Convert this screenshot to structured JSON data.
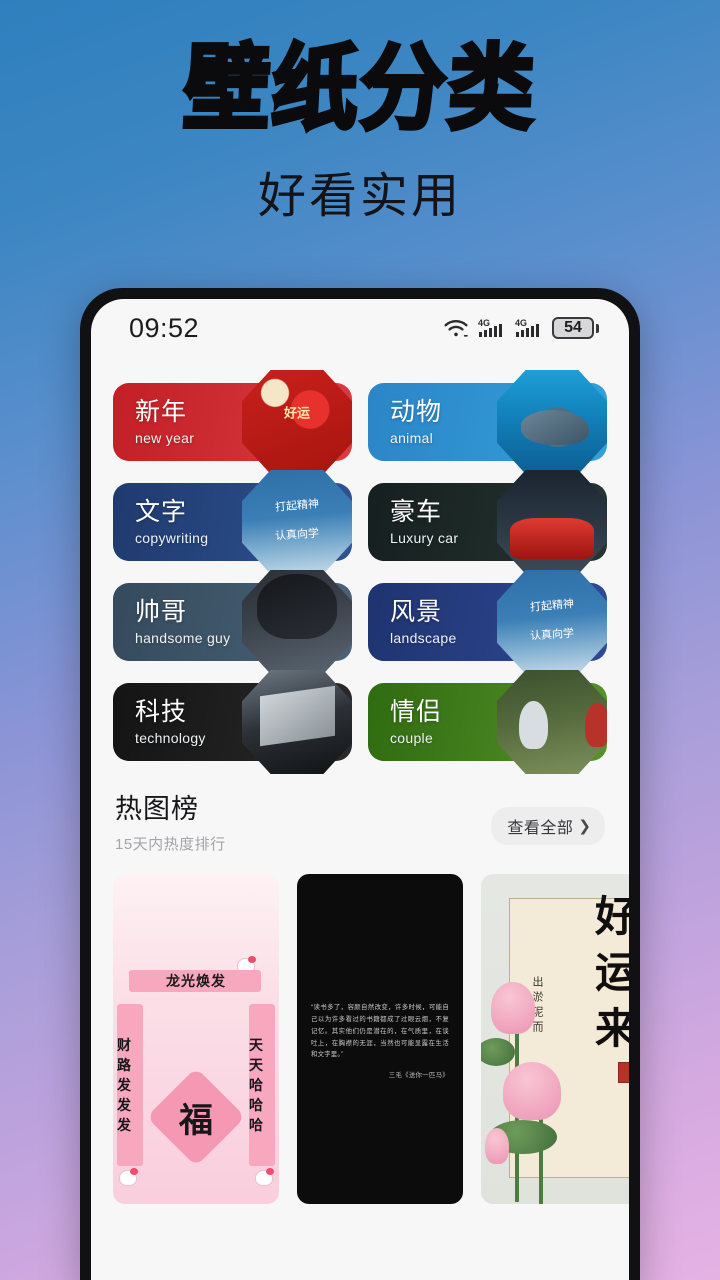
{
  "hero": {
    "title": "壁纸分类",
    "subtitle": "好看实用"
  },
  "phone": {
    "statusbar": {
      "time": "09:52",
      "wifi_icon": "wifi-icon",
      "signal1_label": "4G",
      "signal2_label": "4G",
      "battery_percent": "54"
    }
  },
  "categories": [
    {
      "cn": "新年",
      "en": "new year",
      "color": "#cc2229",
      "art": "art-newyear",
      "name": "new-year"
    },
    {
      "cn": "动物",
      "en": "animal",
      "color": "#2c8fd0",
      "art": "art-dolphin",
      "name": "animal"
    },
    {
      "cn": "文字",
      "en": "copywriting",
      "color": "#27457e",
      "art": "art-typo",
      "name": "copywriting"
    },
    {
      "cn": "豪车",
      "en": "Luxury car",
      "color": "#1d2a2b",
      "art": "art-car",
      "name": "luxury-car"
    },
    {
      "cn": "帅哥",
      "en": "handsome guy",
      "color": "#3b5266",
      "art": "art-man",
      "name": "handsome-guy"
    },
    {
      "cn": "风景",
      "en": "landscape",
      "color": "#24397a",
      "art": "art-typo",
      "name": "landscape"
    },
    {
      "cn": "科技",
      "en": "technology",
      "color": "#181818",
      "art": "art-tech",
      "name": "technology"
    },
    {
      "cn": "情侣",
      "en": "couple",
      "color": "#3f7a18",
      "art": "art-couple",
      "name": "couple"
    }
  ],
  "section": {
    "title": "热图榜",
    "subtitle": "15天内热度排行",
    "see_all_label": "查看全部",
    "chevron_icon": "chevron-right-icon"
  },
  "gallery": [
    {
      "name": "pink-new-year-wallpaper",
      "style": "g-pink",
      "banner_text": "龙光焕发",
      "left_couplet": "财路发发发",
      "right_couplet": "天天哈哈哈",
      "center_char": "福"
    },
    {
      "name": "black-quote-wallpaper",
      "style": "g-black",
      "quote": "“读书多了，容颜自然改变，许多时候，可能自己以为许多看过的书籍都成了过眼云烟，不复记忆。其实他们仍是潜在的，在气质里，在谈吐上，在胸襟的无涯，当然也可能显露在生活和文字里。”",
      "attribution": "三毛《送你一匹马》"
    },
    {
      "name": "lotus-good-luck-wallpaper",
      "style": "g-lotus",
      "big_text": [
        "好",
        "运",
        "来"
      ],
      "small_text": "出淤泥而"
    }
  ],
  "colors": {
    "bg_top": "#2f7fbe",
    "bg_bottom": "#e6b2e4",
    "screen_bg": "#f7f7f7",
    "frame": "#111114",
    "pill_bg": "#ededee"
  }
}
